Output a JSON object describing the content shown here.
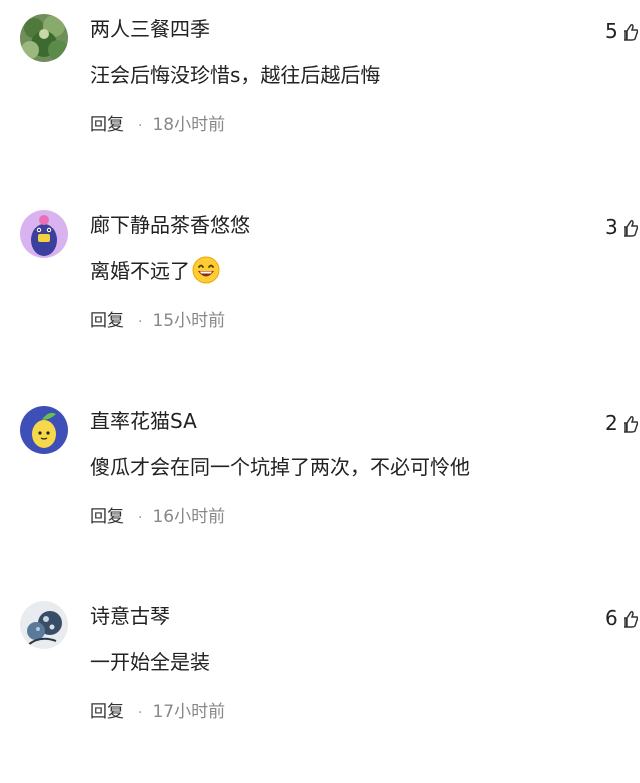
{
  "comments": [
    {
      "username": "两人三餐四季",
      "text": "汪会后悔没珍惜s，越往后越后悔",
      "reply_label": "回复",
      "separator": "·",
      "time": "18小时前",
      "likes": "5",
      "avatar_icon": "green-plant-avatar"
    },
    {
      "username": "廊下静品茶香悠悠",
      "text": "离婚不远了",
      "emoji": "laughing-face-emoji",
      "reply_label": "回复",
      "separator": "·",
      "time": "15小时前",
      "likes": "3",
      "avatar_icon": "purple-cartoon-avatar"
    },
    {
      "username": "直率花猫SA",
      "text": "傻瓜才会在同一个坑掉了两次，不必可怜他",
      "reply_label": "回复",
      "separator": "·",
      "time": "16小时前",
      "likes": "2",
      "avatar_icon": "lemon-cartoon-avatar"
    },
    {
      "username": "诗意古琴",
      "text": "一开始全是装",
      "reply_label": "回复",
      "separator": "·",
      "time": "17小时前",
      "likes": "6",
      "avatar_icon": "night-blossom-avatar"
    }
  ],
  "colors": {
    "text": "#222222",
    "meta": "#888888",
    "background": "#ffffff"
  }
}
